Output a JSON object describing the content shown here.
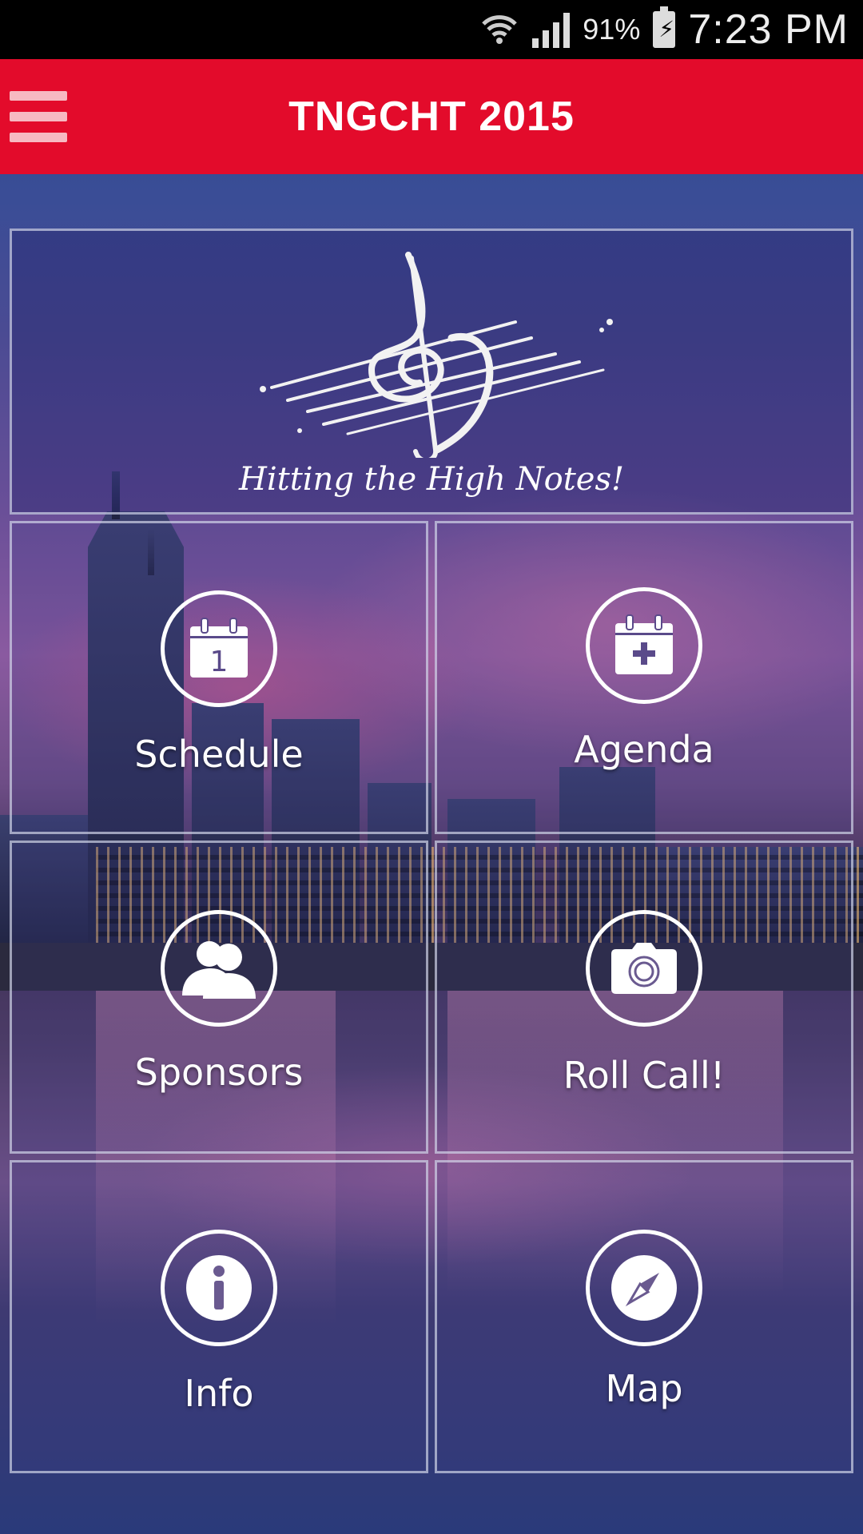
{
  "status_bar": {
    "battery_percent": "91%",
    "time": "7:23 PM",
    "icons": [
      "wifi-icon",
      "signal-icon",
      "battery-charging-icon"
    ]
  },
  "app_bar": {
    "title": "TNGCHT 2015",
    "menu_icon": "hamburger-menu-icon",
    "color": "#e30b2b"
  },
  "banner": {
    "tagline": "Hitting the High Notes!",
    "logo_icon": "music-clef-staff-logo"
  },
  "tiles": [
    {
      "label": "Schedule",
      "icon": "calendar-day-icon",
      "calendar_day": "1"
    },
    {
      "label": "Agenda",
      "icon": "calendar-add-icon"
    },
    {
      "label": "Sponsors",
      "icon": "people-icon"
    },
    {
      "label": "Roll Call!",
      "icon": "camera-icon"
    },
    {
      "label": "Info",
      "icon": "info-icon"
    },
    {
      "label": "Map",
      "icon": "compass-icon"
    }
  ]
}
